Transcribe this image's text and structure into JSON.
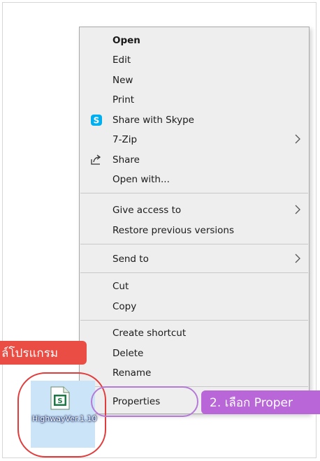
{
  "context_menu": {
    "items": [
      {
        "label": "Open",
        "bold": true
      },
      {
        "label": "Edit"
      },
      {
        "label": "New"
      },
      {
        "label": "Print"
      },
      {
        "label": "Share with Skype",
        "icon": "skype-icon"
      },
      {
        "label": "7-Zip",
        "submenu": true
      },
      {
        "label": "Share",
        "icon": "share-icon"
      },
      {
        "label": "Open with..."
      },
      {
        "label": "Give access to",
        "submenu": true
      },
      {
        "label": "Restore previous versions"
      },
      {
        "label": "Send to",
        "submenu": true
      },
      {
        "label": "Cut"
      },
      {
        "label": "Copy"
      },
      {
        "label": "Create shortcut"
      },
      {
        "label": "Delete"
      },
      {
        "label": "Rename"
      },
      {
        "label": "Properties"
      }
    ]
  },
  "desktop_file": {
    "name": "HighwayVer.1.10",
    "icon": "spreadsheet-file-icon",
    "selected": true
  },
  "annotations": {
    "step1_text": "ล์โปรแกรม",
    "step2_text": "2. เลือก Proper"
  },
  "colors": {
    "menu_bg": "#eeeeee",
    "red_annotation": "#ea4d43",
    "purple_annotation": "#b866d8",
    "file_selection": "#cce4f7",
    "skype_blue": "#00aff0"
  }
}
